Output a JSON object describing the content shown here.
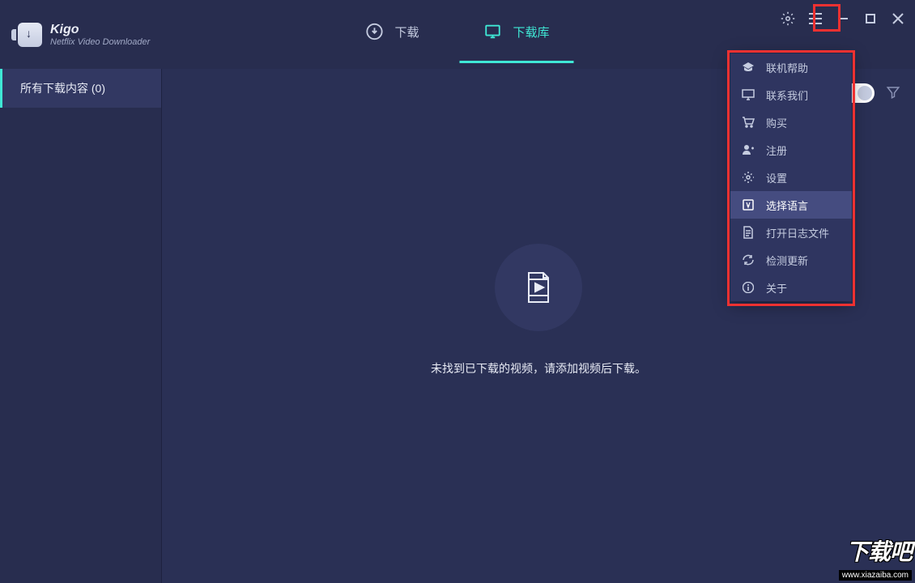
{
  "app": {
    "name": "Kigo",
    "subtitle": "Netflix Video Downloader"
  },
  "tabs": {
    "download": "下载",
    "library": "下载库"
  },
  "sidebar": {
    "all_downloads": "所有下载内容 (0)"
  },
  "empty": {
    "message": "未找到已下载的视频，请添加视频后下载。"
  },
  "menu": {
    "online_help": "联机帮助",
    "contact_us": "联系我们",
    "purchase": "购买",
    "register": "注册",
    "settings": "设置",
    "language": "选择语言",
    "open_log": "打开日志文件",
    "check_update": "检测更新",
    "about": "关于"
  },
  "watermark": {
    "text": "下载吧",
    "url": "www.xiazaiba.com"
  }
}
